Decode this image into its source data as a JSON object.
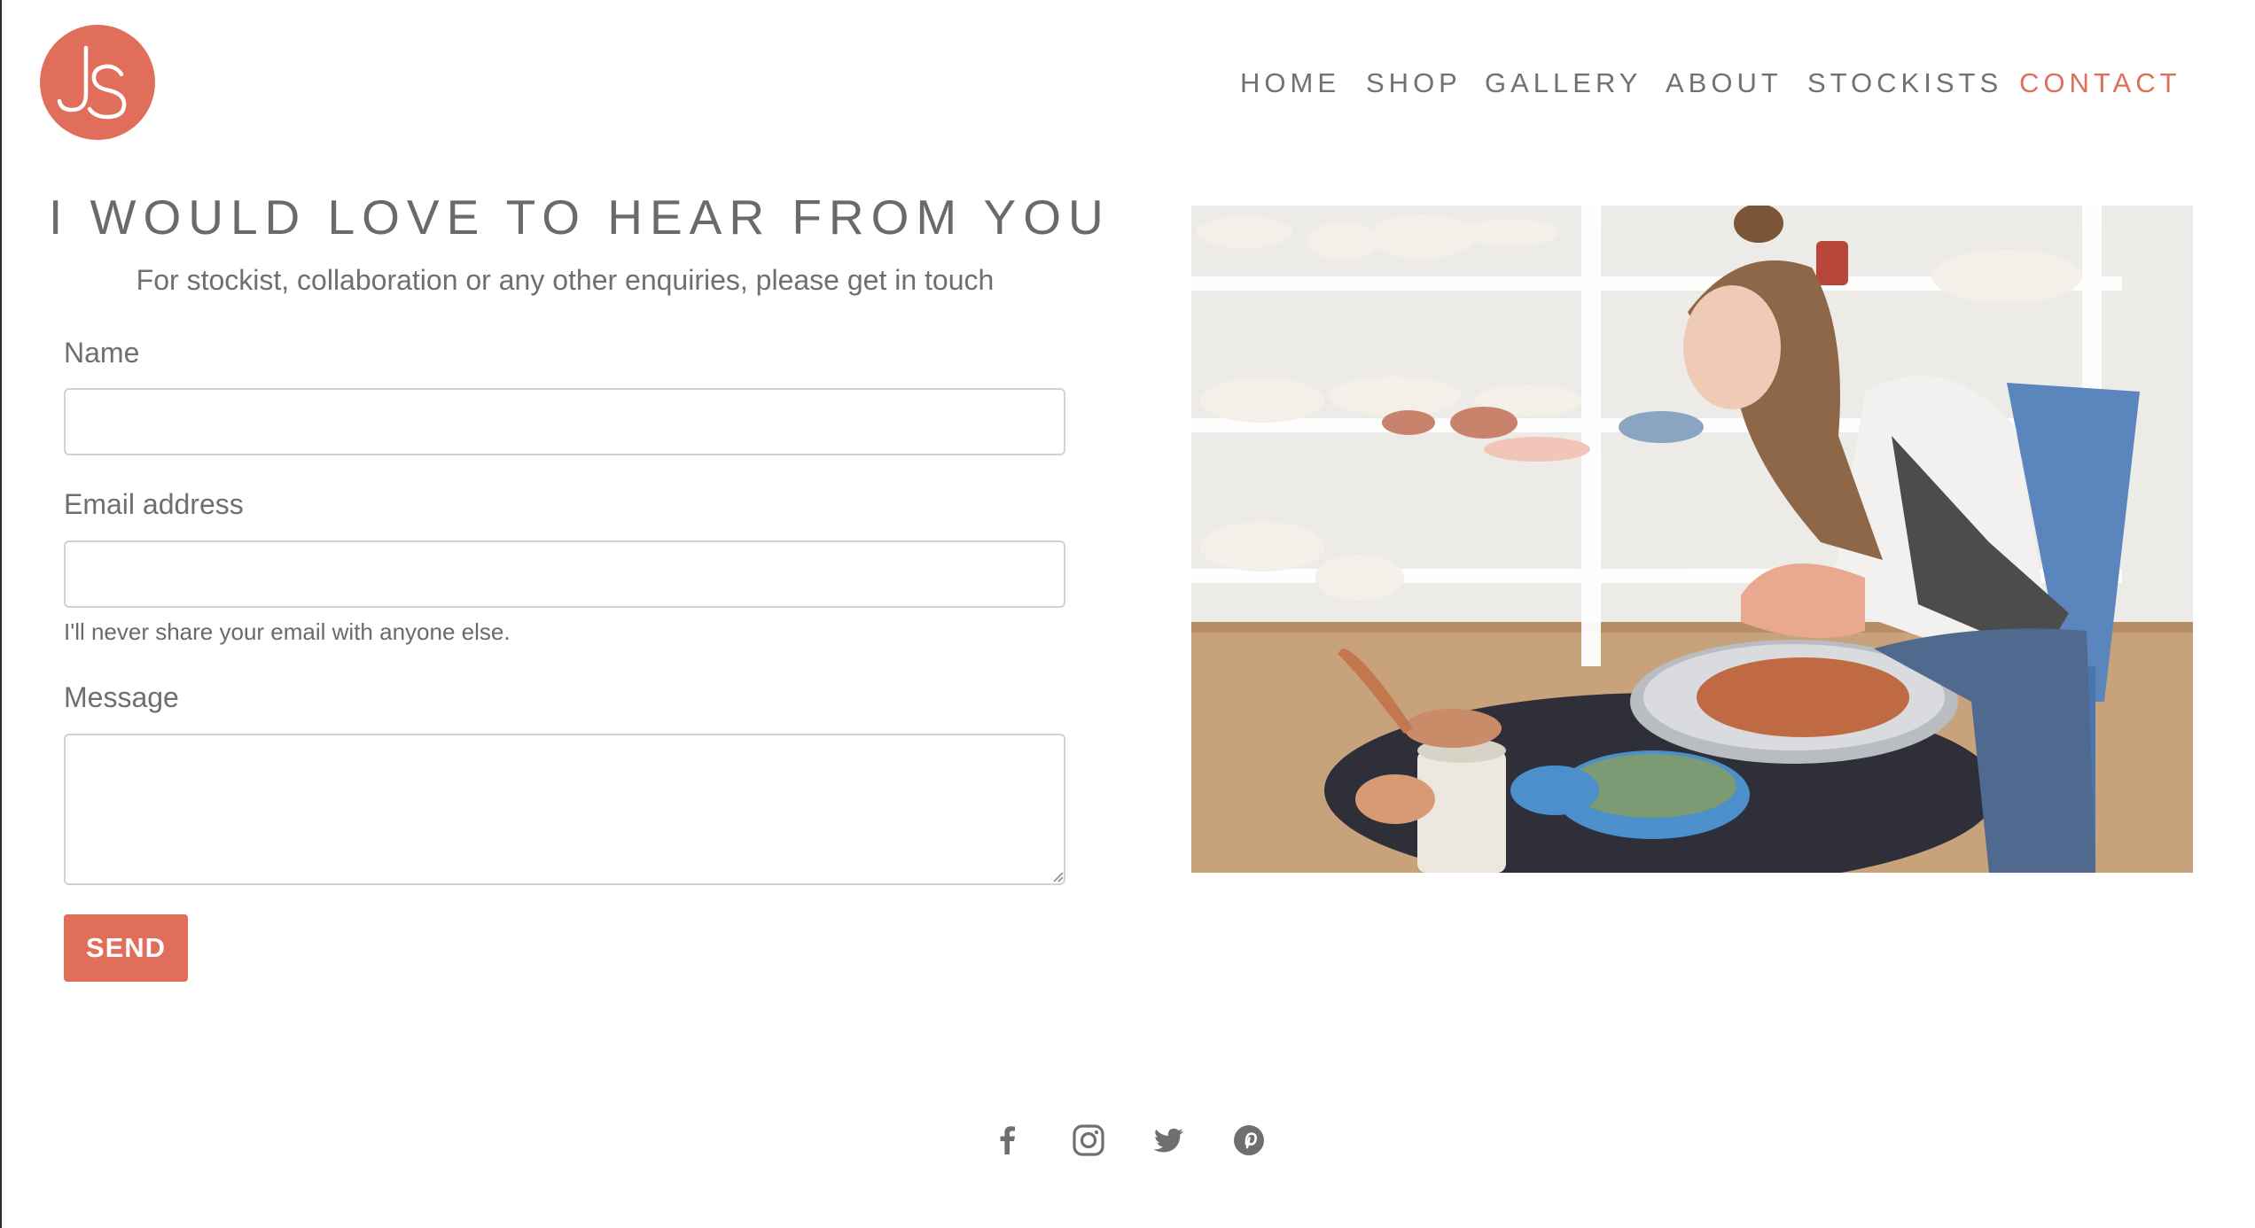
{
  "brand": {
    "logo_text": "JS",
    "accent_color": "#e06e5a"
  },
  "nav": {
    "items": [
      {
        "label": "HOME",
        "active": false
      },
      {
        "label": "SHOP",
        "active": false
      },
      {
        "label": "GALLERY",
        "active": false
      },
      {
        "label": "ABOUT",
        "active": false
      },
      {
        "label": "STOCKISTS",
        "active": false
      },
      {
        "label": "CONTACT",
        "active": true
      }
    ]
  },
  "contact": {
    "title": "I WOULD LOVE TO HEAR FROM YOU",
    "subtitle": "For stockist, collaboration or any other enquiries, please get in touch",
    "name_label": "Name",
    "name_value": "",
    "email_label": "Email address",
    "email_value": "",
    "email_hint": "I'll never share your email with anyone else.",
    "message_label": "Message",
    "message_value": "",
    "send_label": "SEND"
  },
  "image": {
    "subject": "woman shaping clay on a pottery wheel"
  },
  "social": {
    "icons": [
      "facebook-icon",
      "instagram-icon",
      "twitter-icon",
      "pinterest-icon"
    ]
  }
}
